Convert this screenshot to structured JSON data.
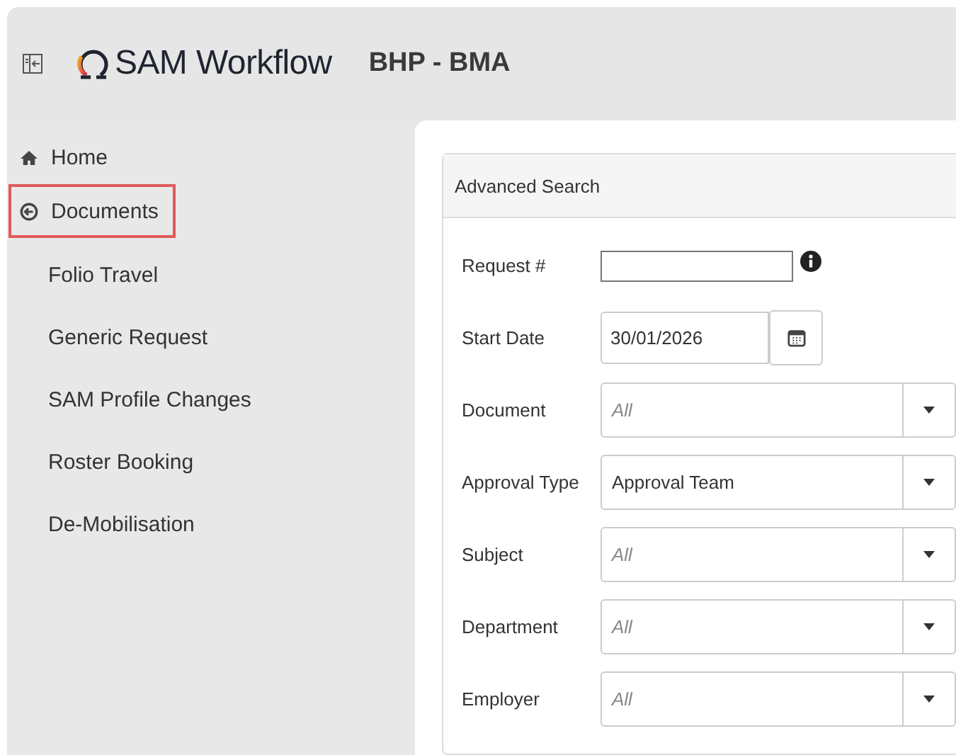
{
  "header": {
    "app_name": "SAM Workflow",
    "company": "BHP - BMA"
  },
  "sidebar": {
    "items": [
      {
        "label": "Home",
        "kind": "home",
        "selected": false
      },
      {
        "label": "Documents",
        "kind": "section",
        "selected": true,
        "children": [
          {
            "label": "Folio Travel"
          },
          {
            "label": "Generic Request"
          },
          {
            "label": "SAM Profile Changes"
          },
          {
            "label": "Roster Booking"
          },
          {
            "label": "De-Mobilisation"
          }
        ]
      }
    ]
  },
  "search": {
    "title": "Advanced Search",
    "fields": [
      {
        "label": "Request #",
        "kind": "text"
      },
      {
        "label": "Start Date",
        "kind": "date",
        "value": "30/01/2026"
      },
      {
        "label": "Document",
        "kind": "select",
        "placeholder": "All"
      },
      {
        "label": "Approval Type",
        "kind": "select",
        "value": "Approval Team"
      },
      {
        "label": "Subject",
        "kind": "select",
        "placeholder": "All"
      },
      {
        "label": "Department",
        "kind": "select",
        "placeholder": "All"
      },
      {
        "label": "Employer",
        "kind": "select",
        "placeholder": "All"
      }
    ]
  }
}
